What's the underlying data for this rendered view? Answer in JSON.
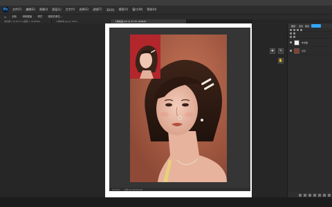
{
  "colors": {
    "accent": "#31a8ff",
    "workspace": "#262626",
    "panel": "#2c2c2c",
    "photo_background": "#b9644d"
  },
  "menubar": {
    "logo": "Ps",
    "items": [
      "文件(F)",
      "编辑(E)",
      "图像(I)",
      "图层(L)",
      "文字(Y)",
      "选择(S)",
      "滤镜(T)",
      "3D(D)",
      "视图(V)",
      "窗口(W)",
      "帮助(H)"
    ]
  },
  "optionsbar": {
    "items": [
      "▭",
      "羽化",
      "消除锯齿",
      "样式",
      "选择并遮住..."
    ]
  },
  "tabs": [
    {
      "label": "未标题-1 @ 66.7% (图层 1, RGB/8#)",
      "active": false
    },
    {
      "label": "人像参考.jpg @ 100%",
      "active": false
    },
    {
      "label": "人物绘画.psd @ 33.3% (RGB/8)",
      "active": true
    }
  ],
  "statusbar": {
    "zoom": "33.33%",
    "info": "文档:20.6M/98.2M"
  },
  "panel": {
    "tabs": [
      "图层",
      "通道",
      "路径"
    ],
    "layers": [
      {
        "name": "参考图",
        "icon": "layer-thumb-icon"
      },
      {
        "name": "背景",
        "icon": "lock-icon"
      }
    ]
  },
  "tool_icons": [
    "move-icon",
    "eyedropper-icon",
    "hand-icon"
  ]
}
